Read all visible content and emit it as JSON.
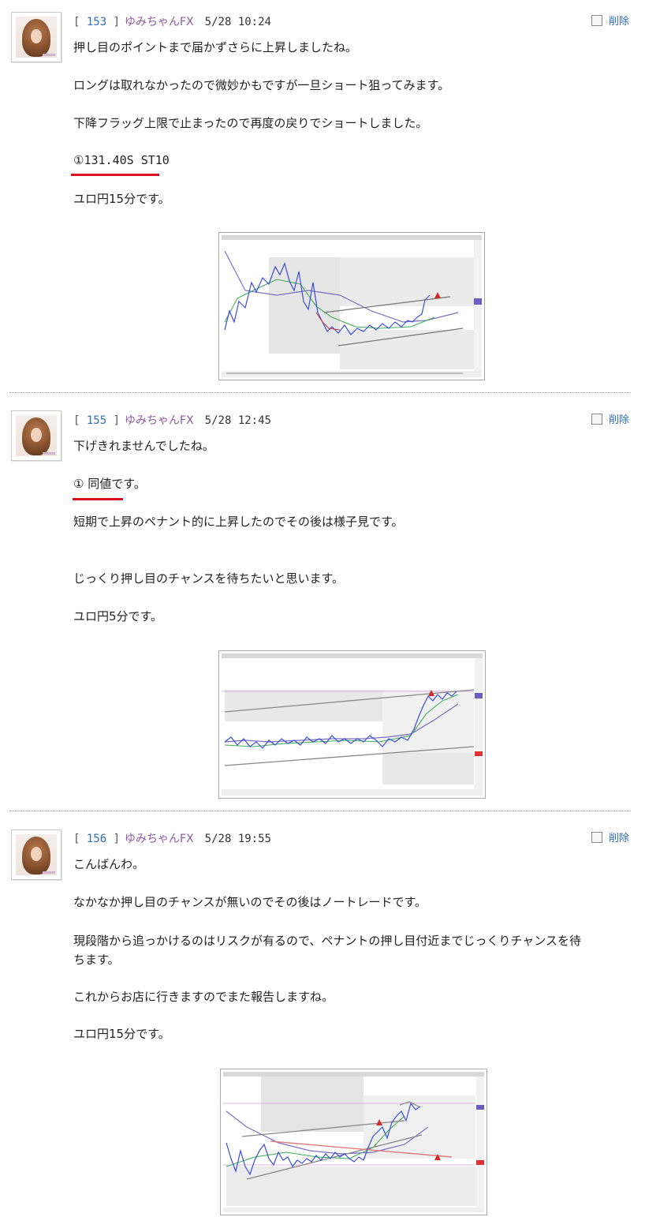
{
  "posts": [
    {
      "num": "153",
      "author": "ゆみちゃんFX",
      "date": "5/28 10:24",
      "delete_label": "削除",
      "lines": [
        "押し目のポイントまで届かずさらに上昇しましたね。",
        "ロングは取れなかったので微妙かもですが一旦ショート狙ってみます。",
        "下降フラッグ上限で止まったので再度の戻りでショートしました。",
        "①131.40S ST10",
        "ユロ円15分です。"
      ],
      "chart_alt": "chart-screenshot"
    },
    {
      "num": "155",
      "author": "ゆみちゃんFX",
      "date": "5/28 12:45",
      "delete_label": "削除",
      "lines": [
        "下げきれませんでしたね。",
        "① 同値です。",
        "短期で上昇のペナント的に上昇したのでその後は様子見です。",
        "じっくり押し目のチャンスを待ちたいと思います。",
        "ユロ円5分です。"
      ],
      "chart_alt": "chart-screenshot"
    },
    {
      "num": "156",
      "author": "ゆみちゃんFX",
      "date": "5/28 19:55",
      "delete_label": "削除",
      "lines": [
        "こんばんわ。",
        "なかなか押し目のチャンスが無いのでその後はノートレードです。",
        "現段階から追っかけるのはリスクが有るので、ペナントの押し目付近までじっくりチャンスを待",
        "ちます。",
        "これからお店に行きますのでまた報告しますね。",
        "ユロ円15分です。"
      ],
      "chart_alt": "chart-screenshot"
    }
  ],
  "colors": {
    "post_number": "#2f6db5",
    "author": "#8f5aa0",
    "delete_link": "#2f6db5",
    "underline": "#d9121f"
  }
}
